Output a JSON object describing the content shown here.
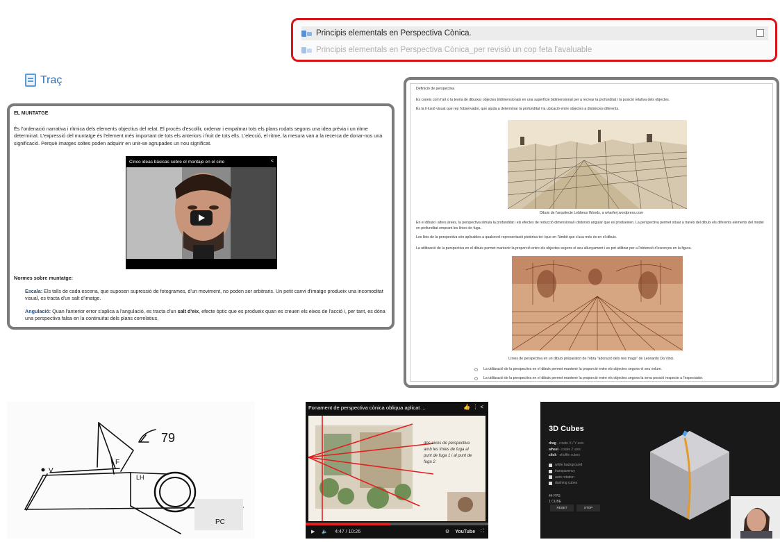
{
  "links": [
    {
      "label": "Principis elementals en Perspectiva Cònica."
    },
    {
      "label": "Principis elementals en Perspectiva Cònica_per revisió un cop feta l'avaluable"
    }
  ],
  "section": {
    "title": "Traç"
  },
  "montatge": {
    "heading": "EL MUNTATGE",
    "paragraph": "És l'ordenació narrativa i rítmica dels elements objectius del relat. El procés d'escollir, ordenar i empalmar tots els plans rodats segons una idea prèvia i un ritme determinat. L'expressió del muntatge és l'element més important de tots els anteriors i fruit de tots ells. L'elecció, el ritme, la mesura van a la recerca de donar-nos una significació. Perquè imatges soltes poden adquirir en unir-se agrupades un nou significat.",
    "video_title": "Cinco ideas básicas sobre el montaje en el cine",
    "norms_heading": "Normes sobre muntatge:",
    "item1_term": "Escala:",
    "item1_text": " Els talls de cada escena, que suposen supressió de fotogrames, d'un moviment, no poden ser arbitraris. Un petit canvi d'imatge produeix una incomoditat visual, es tracta d'un salt d'imatge.",
    "item2_term": "Angulació:",
    "item2_text_a": " Quan l'anterior error s'aplica a l'angulació, es tracta d'un ",
    "item2_bold": "salt d'eix",
    "item2_text_b": ", efecte òptic que es produeix quan es creuen els eixos de l'acció i, per tant, es dóna una perspectiva falsa en la continuïtat dels plans correlatius."
  },
  "perspectiva": {
    "heading": "Definició de perspectiva",
    "p1": "Es coneix com l'art o la teoria de dibuixar objectes tridimensionals en una superfície bidimensional per a recrear la profunditat i la posició relativa dels objectes.",
    "p2": "És la il·lusió visual que rep l'observador, que ajuda a determinar la profunditat i la ubicació entre objectes a distàncies diferents.",
    "caption1": "Dibuix de l'arquitecte Lebbeus Woods, a wharferj.wordpress.com",
    "p3": "En el dibuix i altres àrees, la perspectiva simula la profunditat i els efectes de reducció dimensional i distorsió angular que es produeixen. La perspectiva permet situar a través del dibuix els diferents elements del model en profunditat emprant les línies de fuga.",
    "p4": "Les lleis de la perspectiva són aplicables a qualsevol representació pictòrica tot i que en l'àmbit que s'usa més és en el dibuix.",
    "p5": "La utilització de la perspectiva en el dibuix permet mantenir la proporció entre els objectes segons el seu allunyament i es pot utilitzar per a l'obtenció d'escorços en la figura.",
    "caption2": "Línies de perspectiva en un dibuix preparatori de l'obra \"adoració dels reis mags\" de Leonardo Da Vinci.",
    "opt1": "La utilització de la perspectiva en el dibuix permet mantenir la proporció entre els objectes segons el seu volum.",
    "opt2": "La utilització de la perspectiva en el dibuix permet mantenir la proporció entre els objectes segons la seva posició respecte a l'espectador."
  },
  "sketch": {
    "label_a": "79",
    "label_v": "V",
    "label_f": "F",
    "label_lh": "LH",
    "label_pc": "PC"
  },
  "youtube": {
    "title": "Fonament de perspectiva cònica obliqua aplicat ...",
    "time": "4:47 / 10:26",
    "brand": "YouTube",
    "progress": 0.46,
    "note": "dos eixos de perspectiva amb les línies de fuga al punt de fuga 1 i al punt de fuga 2"
  },
  "cubes": {
    "title": "3D Cubes",
    "keys": [
      {
        "k": "drag",
        "v": "- rotate X / Y axis"
      },
      {
        "k": "wheel",
        "v": "- rotate Z axis"
      },
      {
        "k": "click",
        "v": "- shuffle cubes"
      }
    ],
    "options": [
      "white background",
      "transparency",
      "auto rotation",
      "dashing cubes"
    ],
    "stats": [
      "44 FPS",
      "1 CUBE"
    ],
    "reset": "RESET",
    "stop": "STOP"
  },
  "colors": {
    "highlight": "#d8141b",
    "link": "#2c6fb3",
    "frame": "#7b7b7b",
    "yt_red": "#e21f1f"
  }
}
